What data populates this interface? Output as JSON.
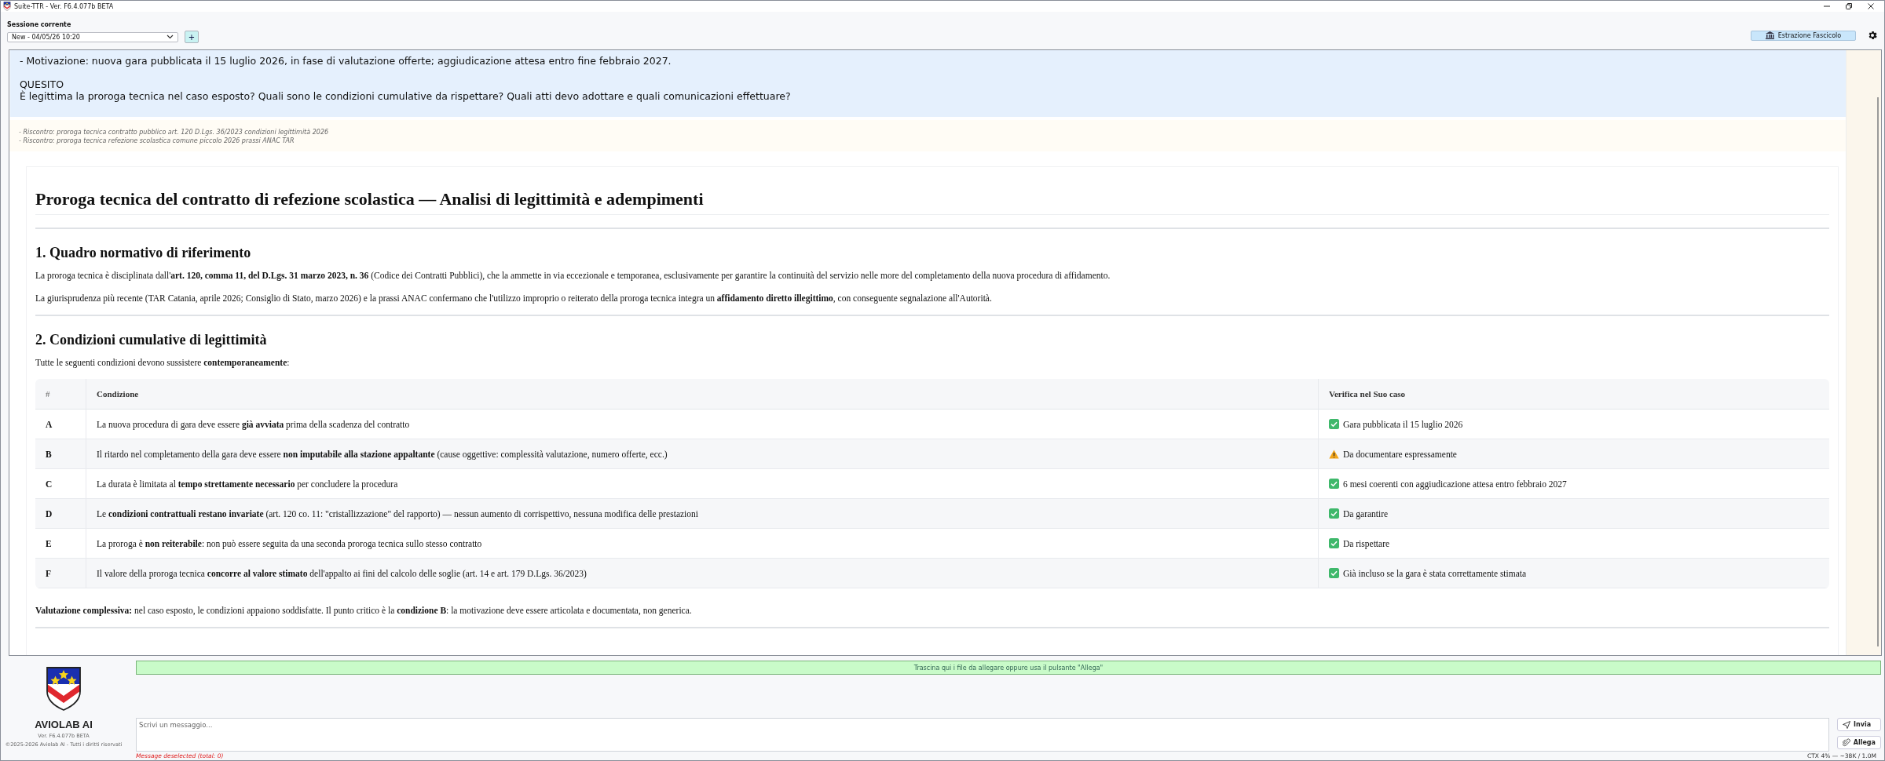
{
  "window": {
    "title": "Suite-TTR - Ver. F6.4.077b BETA"
  },
  "header": {
    "session_label": "Sessione corrente",
    "session_value": "New - 04/05/26 10:20",
    "add_button": "+",
    "extract_button": "Estrazione Fascicolo"
  },
  "question": {
    "blocks": [
      [
        "- Motivazione: nuova gara pubblicata il 15 luglio 2026, in fase di valutazione offerte; aggiudicazione attesa entro fine febbraio 2027."
      ],
      [
        "QUESITO",
        "È legittima la proroga tecnica nel caso esposto? Quali sono le condizioni cumulative da rispettare? Quali atti devo adottare e quali comunicazioni effettuare?"
      ]
    ]
  },
  "sources": [
    "- Riscontro: proroga tecnica contratto pubblico art. 120 D.Lgs. 36/2023 condizioni legittimità 2026",
    "- Riscontro: proroga tecnica refezione scolastica comune piccolo 2026 prassi ANAC TAR"
  ],
  "answer": {
    "blocks": [
      {
        "kind": "title",
        "text": "Proroga tecnica del contratto di refezione scolastica — Analisi di legittimità e adempimenti"
      },
      {
        "kind": "rule"
      },
      {
        "kind": "heading",
        "text": "1. Quadro normativo di riferimento"
      },
      {
        "kind": "paragraph",
        "text": "La proroga tecnica è disciplinata dall'**art. 120, comma 11, del D.Lgs. 31 marzo 2023, n. 36** (Codice dei Contratti Pubblici), che la ammette in via eccezionale e temporanea, esclusivamente per garantire la continuità del servizio nelle more del completamento della nuova procedura di affidamento."
      },
      {
        "kind": "paragraph",
        "text": "La giurisprudenza più recente (TAR Catania, aprile 2026; Consiglio di Stato, marzo 2026) e la prassi ANAC confermano che l'utilizzo improprio o reiterato della proroga tecnica integra un **affidamento diretto illegittimo**, con conseguente segnalazione all'Autorità."
      },
      {
        "kind": "rule"
      },
      {
        "kind": "heading",
        "text": "2. Condizioni cumulative di legittimità"
      },
      {
        "kind": "paragraph",
        "text": "Tutte le seguenti condizioni devono sussistere **contemporaneamente**:"
      },
      {
        "kind": "table",
        "columns": [
          "#",
          "Condizione",
          "Verifica nel Suo caso"
        ],
        "rows": [
          {
            "id": "A",
            "condition": "La nuova procedura di gara deve essere **già avviata** prima della scadenza del contratto",
            "kind": "ok",
            "check": "Gara pubblicata il 15 luglio 2026"
          },
          {
            "id": "B",
            "condition": "Il ritardo nel completamento della gara deve essere **non imputabile alla stazione appaltante** (cause oggettive: complessità valutazione, numero offerte, ecc.)",
            "kind": "warning",
            "check": "Da documentare espressamente"
          },
          {
            "id": "C",
            "condition": "La durata è limitata al **tempo strettamente necessario** per concludere la procedura",
            "kind": "ok",
            "check": "6 mesi coerenti con aggiudicazione attesa entro febbraio 2027"
          },
          {
            "id": "D",
            "condition": "Le **condizioni contrattuali restano invariate** (art. 120 co. 11: \"cristallizzazione\" del rapporto) — nessun aumento di corrispettivo, nessuna modifica delle prestazioni",
            "kind": "ok",
            "check": "Da garantire"
          },
          {
            "id": "E",
            "condition": "La proroga è **non reiterabile**: non può essere seguita da una seconda proroga tecnica sullo stesso contratto",
            "kind": "ok",
            "check": "Da rispettare"
          },
          {
            "id": "F",
            "condition": "Il valore della proroga tecnica **concorre al valore stimato** dell'appalto ai fini del calcolo delle soglie (art. 14 e art. 179 D.Lgs. 36/2023)",
            "kind": "ok",
            "check": "Già incluso se la gara è stata correttamente stimata"
          }
        ]
      },
      {
        "kind": "paragraph",
        "text": "**Valutazione complessiva:** nel caso esposto, le condizioni appaiono soddisfatte. Il punto critico è la **condizione B**: la motivazione deve essere articolata e documentata, non generica."
      },
      {
        "kind": "rule"
      }
    ]
  },
  "footer": {
    "brand": "AVIOLAB AI",
    "version": "Ver. F6.4.077b BETA",
    "copyright": "©2025-2026 Aviolab AI - Tutti i diritti riservati",
    "dropzone": "Trascina qui i file da allegare oppure usa il pulsante \"Allega\"",
    "message_placeholder": "Scrivi un messaggio...",
    "send_button": "Invia",
    "attach_button": "Allega"
  },
  "status_bar": {
    "left": "Message deselected (total: 0)",
    "right": "CTX 4% — ~38K / 1.0M"
  }
}
